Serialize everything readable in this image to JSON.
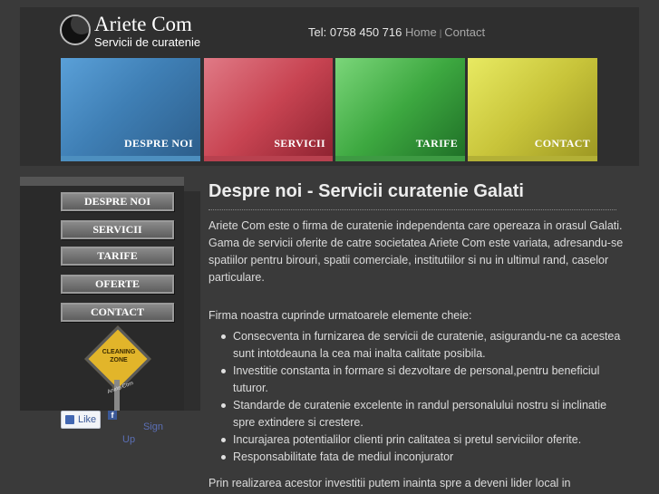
{
  "brand": {
    "name": "Ariete Com",
    "tagline": "Servicii de curatenie"
  },
  "topbar": {
    "tel": "Tel: 0758 450 716",
    "home": "Home",
    "separator": "|",
    "contact": "Contact"
  },
  "banners": [
    {
      "label": "DESPRE NOI",
      "color": "#3f7fb5"
    },
    {
      "label": "SERVICII",
      "color": "#c84452"
    },
    {
      "label": "TARIFE",
      "color": "#3da840"
    },
    {
      "label": "CONTACT",
      "color": "#c8c43a"
    }
  ],
  "sidebar": {
    "menu": [
      "DESPRE NOI",
      "SERVICII",
      "TARIFE",
      "OFERTE",
      "CONTACT"
    ],
    "badge": {
      "text": "CLEANING ZONE",
      "sign": "Ariete Com"
    }
  },
  "social": {
    "like": "Like",
    "signup_line1": "Sign",
    "signup_line2": "Up"
  },
  "main": {
    "title": "Despre noi - Servicii curatenie Galati",
    "intro": "Ariete Com este o firma de curatenie independenta care opereaza in orasul Galati. Gama de servicii oferite de catre societatea Ariete Com este variata, adresandu-se spatiilor pentru birouri, spatii comerciale, institutiilor si nu in ultimul rand, caselor particulare.",
    "elements_intro": "Firma noastra cuprinde urmatoarele elemente cheie:",
    "bullets": [
      "Consecventa in furnizarea de servicii de curatenie, asigurandu-ne ca acestea sunt intotdeauna la cea mai inalta calitate posibila.",
      "Investitie constanta in formare si dezvoltare de personal,pentru beneficiul tuturor.",
      "Standarde de curatenie excelente in randul personalului nostru si inclinatie spre extindere si crestere.",
      "Incurajarea potentialilor clienti prin calitatea si pretul serviciilor oferite.",
      "Responsabilitate fata de mediul inconjurator"
    ],
    "closing": "Prin realizarea acestor investitii putem inainta spre a deveni lider local in"
  }
}
